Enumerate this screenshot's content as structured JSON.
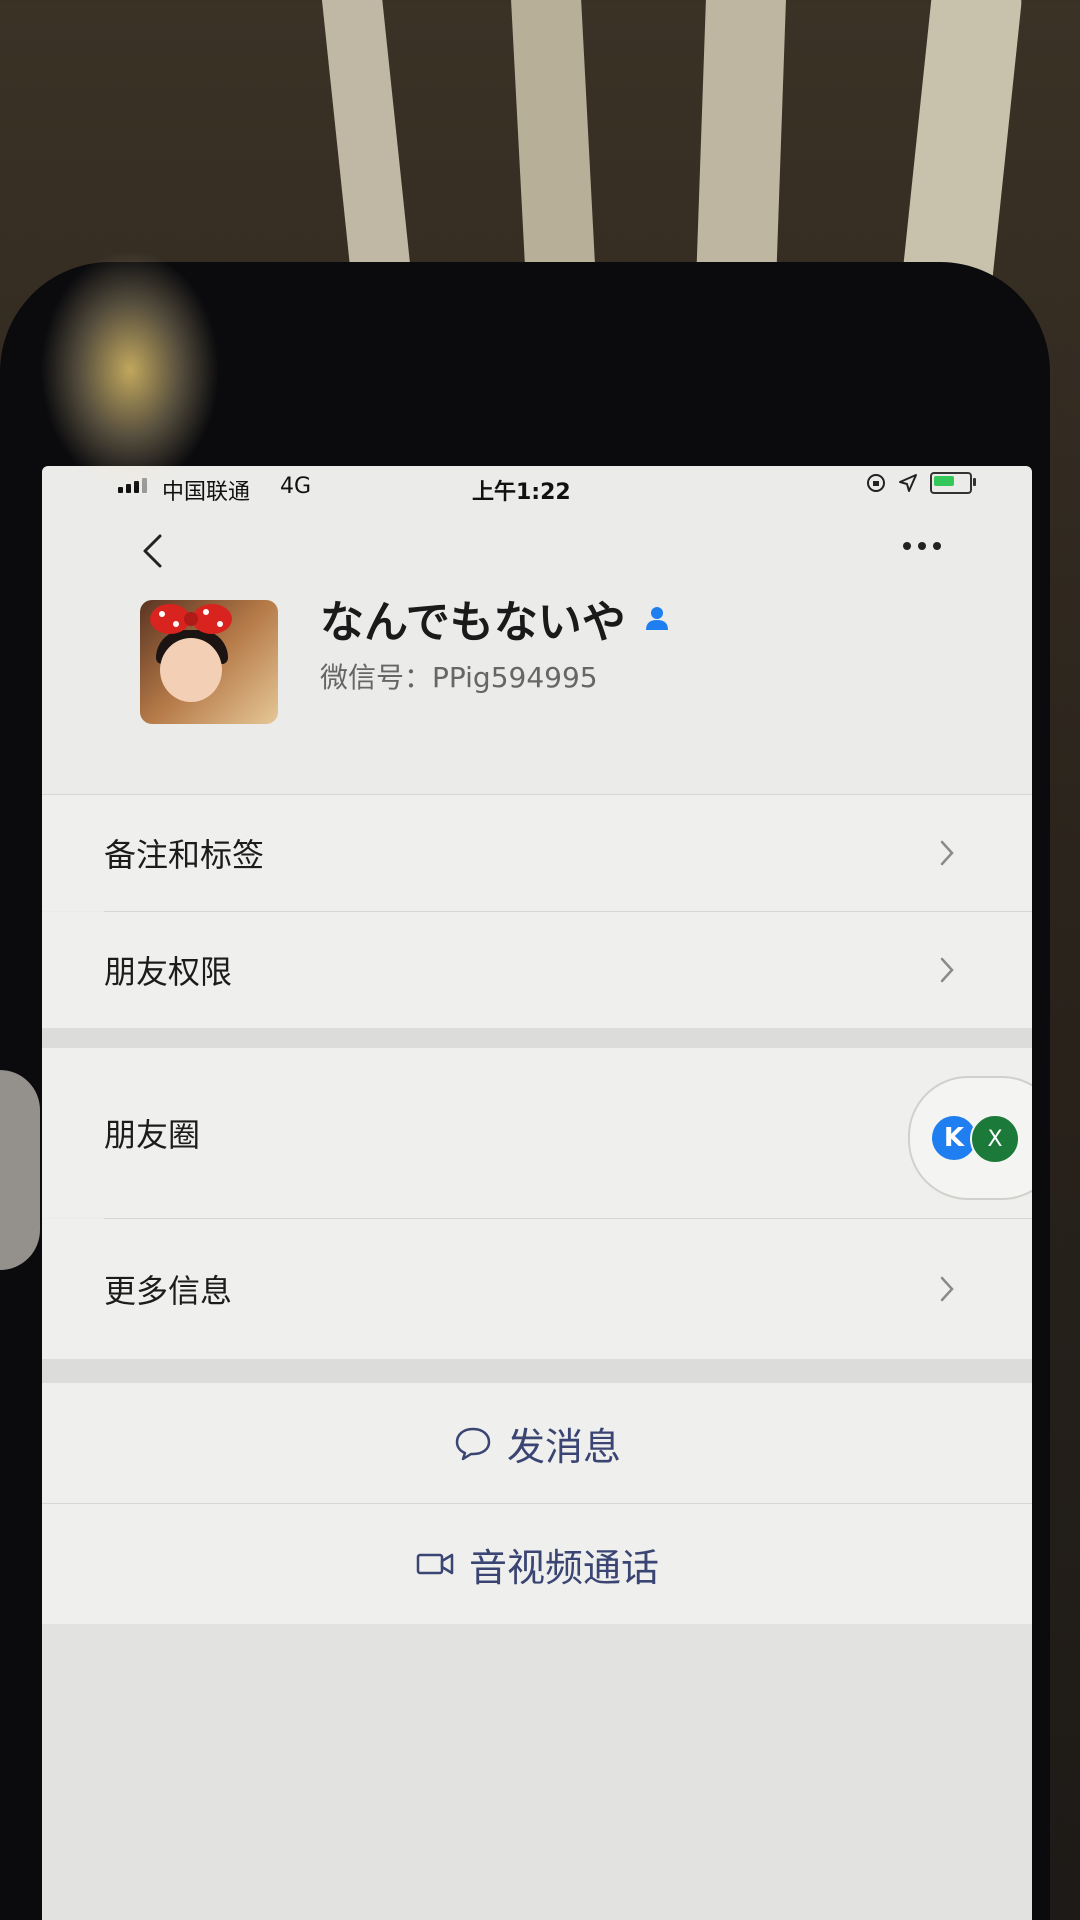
{
  "status_bar": {
    "carrier": "中国联通",
    "network": "4G",
    "time": "上午1:22"
  },
  "nav": {
    "back_icon": "chevron-left-icon",
    "more_icon": "ellipsis-icon"
  },
  "profile": {
    "name": "なんでもないや",
    "wechat_id": "微信号：PPig594995"
  },
  "menu": {
    "remark_tags": "备注和标签",
    "friend_permissions": "朋友权限",
    "moments": "朋友圈",
    "more_info": "更多信息"
  },
  "floating_bubble": {
    "k_label": "K",
    "x_label": "X"
  },
  "actions": {
    "send_message": "发消息",
    "video_call": "音视频通话"
  },
  "colors": {
    "action_text": "#3a4574",
    "contact_badge": "#1f7ef0",
    "excel_green": "#1b7a3a"
  }
}
